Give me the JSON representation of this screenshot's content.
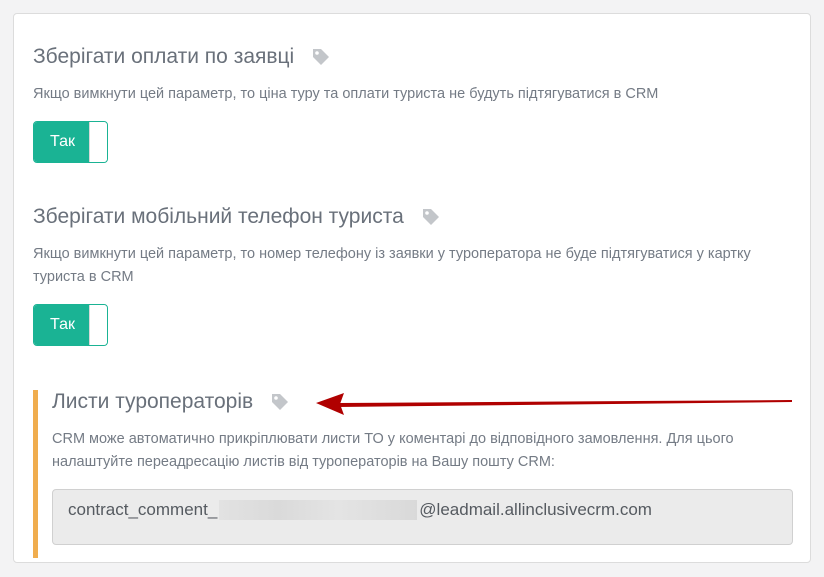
{
  "sections": [
    {
      "title": "Зберігати оплати по заявці",
      "description": "Якщо вимкнути цей параметр, то ціна туру та оплати туриста не будуть підтягуватися в CRM",
      "toggle_label": "Так"
    },
    {
      "title": "Зберігати мобільний телефон туриста",
      "description": "Якщо вимкнути цей параметр, то номер телефону із заявки у туроператора не буде підтягуватися у картку туриста в CRM",
      "toggle_label": "Так"
    },
    {
      "title": "Листи туроператорів",
      "description": "CRM може автоматично прикріплювати листи ТО у коментарі до відповідного замовлення. Для цього налаштуйте переадресацію листів від туроператорів на Вашу пошту CRM:",
      "email_prefix": "contract_comment_",
      "email_suffix": "@leadmail.allinclusivecrm.com"
    }
  ],
  "colors": {
    "toggle_on": "#1ab394",
    "highlight_bar": "#f0ad4e",
    "arrow": "#b00000"
  },
  "icons": {
    "section_tag": "tag-icon",
    "annotation": "arrow-icon"
  }
}
